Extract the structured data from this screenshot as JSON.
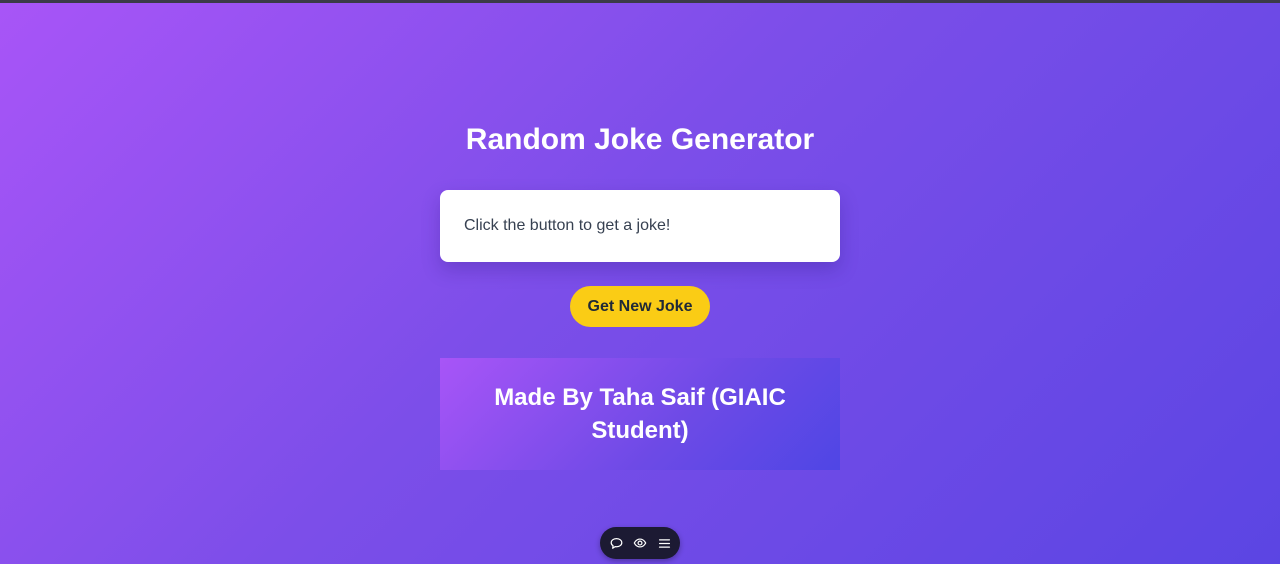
{
  "page": {
    "title": "Random Joke Generator"
  },
  "joke": {
    "text": "Click the button to get a joke!"
  },
  "actions": {
    "get_joke_label": "Get New Joke"
  },
  "credit": {
    "text": "Made By Taha Saif (GIAIC Student)"
  },
  "toolbar": {
    "icons": [
      "comment-icon",
      "eye-icon",
      "menu-icon"
    ]
  },
  "colors": {
    "background_start": "#a855f7",
    "background_end": "#5b45e3",
    "button": "#facc15",
    "card": "#ffffff"
  }
}
